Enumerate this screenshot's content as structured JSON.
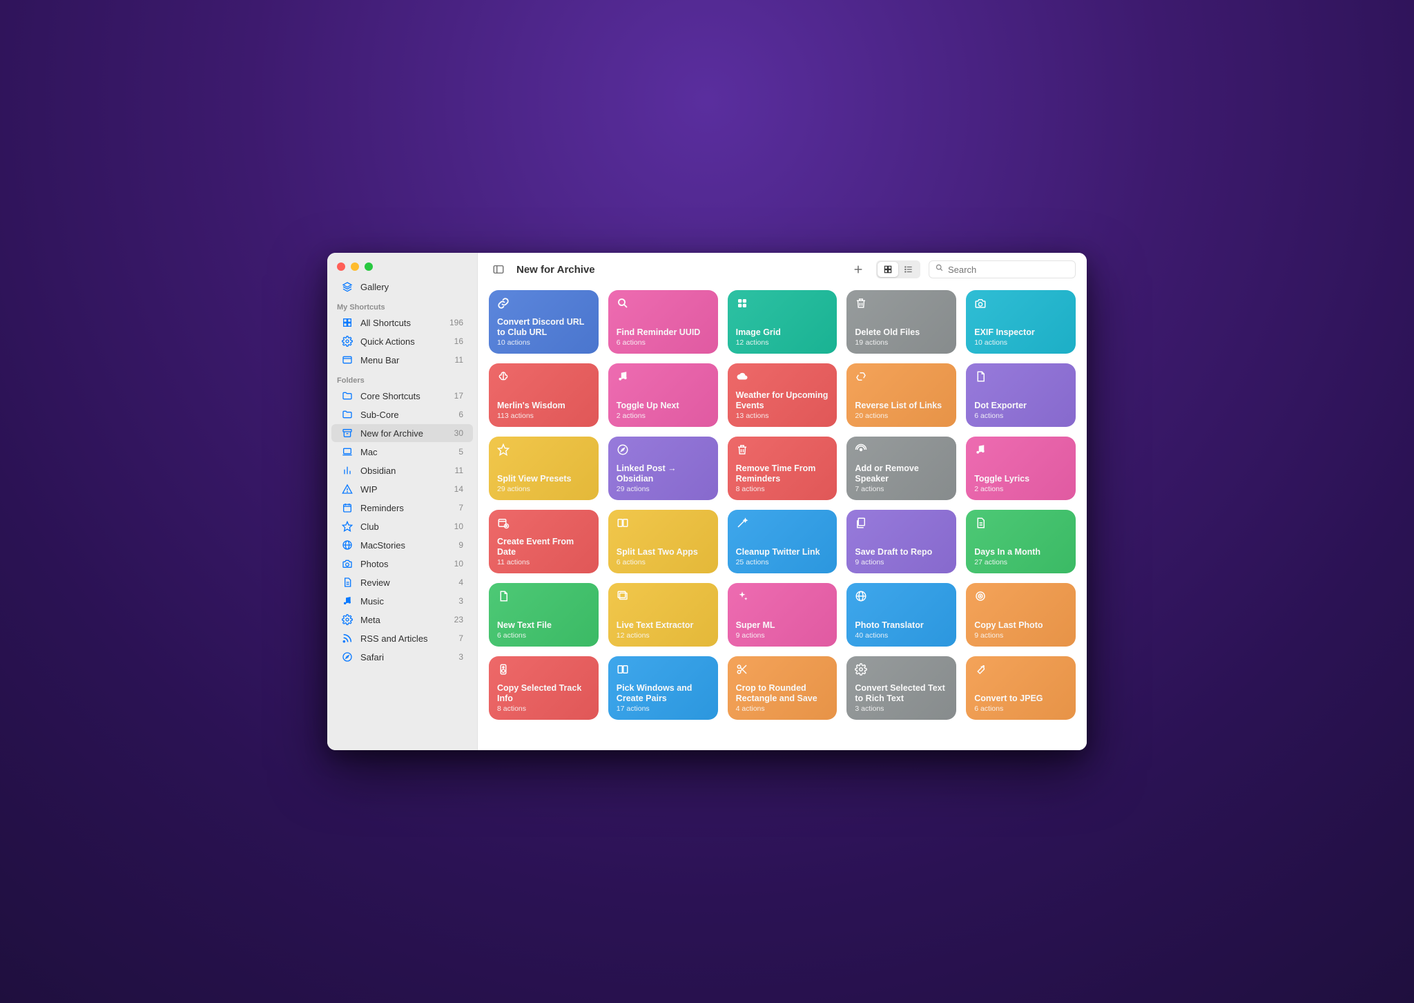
{
  "header": {
    "title": "New for Archive",
    "search_placeholder": "Search"
  },
  "sidebar": {
    "gallery_label": "Gallery",
    "section_shortcuts": "My Shortcuts",
    "section_folders": "Folders",
    "shortcuts": [
      {
        "icon": "grid",
        "label": "All Shortcuts",
        "count": "196"
      },
      {
        "icon": "gear",
        "label": "Quick Actions",
        "count": "16"
      },
      {
        "icon": "window",
        "label": "Menu Bar",
        "count": "11"
      }
    ],
    "folders": [
      {
        "icon": "folder",
        "label": "Core Shortcuts",
        "count": "17",
        "selected": false
      },
      {
        "icon": "folder",
        "label": "Sub-Core",
        "count": "6"
      },
      {
        "icon": "archive",
        "label": "New for Archive",
        "count": "30",
        "selected": true
      },
      {
        "icon": "laptop",
        "label": "Mac",
        "count": "5"
      },
      {
        "icon": "chart",
        "label": "Obsidian",
        "count": "11"
      },
      {
        "icon": "warning",
        "label": "WIP",
        "count": "14"
      },
      {
        "icon": "calendar",
        "label": "Reminders",
        "count": "7"
      },
      {
        "icon": "star",
        "label": "Club",
        "count": "10"
      },
      {
        "icon": "globe",
        "label": "MacStories",
        "count": "9"
      },
      {
        "icon": "camera",
        "label": "Photos",
        "count": "10"
      },
      {
        "icon": "doc",
        "label": "Review",
        "count": "4"
      },
      {
        "icon": "music",
        "label": "Music",
        "count": "3"
      },
      {
        "icon": "gear",
        "label": "Meta",
        "count": "23"
      },
      {
        "icon": "rss",
        "label": "RSS and Articles",
        "count": "7"
      },
      {
        "icon": "compass",
        "label": "Safari",
        "count": "3"
      }
    ]
  },
  "shortcuts": [
    {
      "icon": "link",
      "title": "Convert Discord URL to Club URL",
      "actions": 10,
      "color": "#4E7CD9"
    },
    {
      "icon": "search",
      "title": "Find Reminder UUID",
      "actions": 6,
      "color": "#EC5FAA"
    },
    {
      "icon": "grid4",
      "title": "Image Grid",
      "actions": 12,
      "color": "#1BBC9B"
    },
    {
      "icon": "trash",
      "title": "Delete Old Files",
      "actions": 19,
      "color": "#8E9394"
    },
    {
      "icon": "camera",
      "title": "EXIF Inspector",
      "actions": 10,
      "color": "#1EB8D1"
    },
    {
      "icon": "brain",
      "title": "Merlin's Wisdom",
      "actions": 113,
      "color": "#EC5C5C"
    },
    {
      "icon": "music",
      "title": "Toggle Up Next",
      "actions": 2,
      "color": "#EC5FAA"
    },
    {
      "icon": "cloud",
      "title": "Weather for Upcoming Events",
      "actions": 13,
      "color": "#EC5C5C"
    },
    {
      "icon": "recycle",
      "title": "Reverse List of Links",
      "actions": 20,
      "color": "#F39B4B"
    },
    {
      "icon": "file",
      "title": "Dot Exporter",
      "actions": 6,
      "color": "#8E6FD8"
    },
    {
      "icon": "star",
      "title": "Split View Presets",
      "actions": 29,
      "color": "#F0C23C"
    },
    {
      "icon": "compass",
      "title": "Linked Post → Obsidian",
      "actions": 29,
      "color": "#8E6FD8"
    },
    {
      "icon": "trash",
      "title": "Remove Time From Reminders",
      "actions": 8,
      "color": "#EC5C5C"
    },
    {
      "icon": "broadcast",
      "title": "Add or Remove Speaker",
      "actions": 7,
      "color": "#8E9394"
    },
    {
      "icon": "music",
      "title": "Toggle Lyrics",
      "actions": 2,
      "color": "#EC5FAA"
    },
    {
      "icon": "calplus",
      "title": "Create Event From Date",
      "actions": 11,
      "color": "#EC5C5C"
    },
    {
      "icon": "split",
      "title": "Split Last Two Apps",
      "actions": 6,
      "color": "#F0C23C"
    },
    {
      "icon": "wand",
      "title": "Cleanup Twitter Link",
      "actions": 25,
      "color": "#2E9FEA"
    },
    {
      "icon": "docstack",
      "title": "Save Draft to Repo",
      "actions": 9,
      "color": "#8E6FD8"
    },
    {
      "icon": "doc",
      "title": "Days In a Month",
      "actions": 27,
      "color": "#3EC46A"
    },
    {
      "icon": "file",
      "title": "New Text File",
      "actions": 6,
      "color": "#3EC46A"
    },
    {
      "icon": "images",
      "title": "Live Text Extractor",
      "actions": 12,
      "color": "#F0C23C"
    },
    {
      "icon": "sparkle",
      "title": "Super ML",
      "actions": 9,
      "color": "#EC5FAA"
    },
    {
      "icon": "globe",
      "title": "Photo Translator",
      "actions": 40,
      "color": "#2E9FEA"
    },
    {
      "icon": "target",
      "title": "Copy Last Photo",
      "actions": 9,
      "color": "#F39B4B"
    },
    {
      "icon": "speaker",
      "title": "Copy Selected Track Info",
      "actions": 8,
      "color": "#EC5C5C"
    },
    {
      "icon": "split",
      "title": "Pick Windows and Create Pairs",
      "actions": 17,
      "color": "#2E9FEA"
    },
    {
      "icon": "scissors",
      "title": "Crop to Rounded Rectangle and Save",
      "actions": 4,
      "color": "#F39B4B"
    },
    {
      "icon": "gear",
      "title": "Convert Selected Text to Rich Text",
      "actions": 3,
      "color": "#8E9394"
    },
    {
      "icon": "wrench",
      "title": "Convert to JPEG",
      "actions": 6,
      "color": "#F39B4B"
    }
  ]
}
